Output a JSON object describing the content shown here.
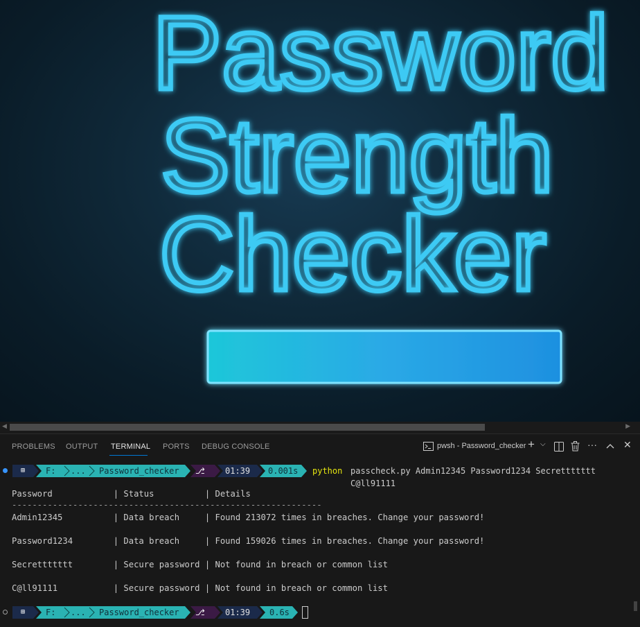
{
  "hero": {
    "title_lines": [
      "Password",
      "Strength",
      "Checker"
    ],
    "colors": {
      "text": "#3ecaf4",
      "bar": "#2ab7e0"
    }
  },
  "panel": {
    "tabs": [
      "PROBLEMS",
      "OUTPUT",
      "TERMINAL",
      "PORTS",
      "DEBUG CONSOLE"
    ],
    "active_tab": "TERMINAL",
    "terminal_name": "pwsh - Password_checker",
    "actions": {
      "add": "+",
      "dropdown": "⌵",
      "split": "split-icon",
      "trash": "trash-icon",
      "more": "···",
      "maximize": "^",
      "close": "✕"
    }
  },
  "prompt1": {
    "drive": "F:",
    "ellipsis": "...",
    "folder": "Password_checker",
    "time": "01:39",
    "duration": "0.001s",
    "command_keyword": "python",
    "command_args": "passcheck.py Admin12345 Password1234 Secrettttttt C@ll91111"
  },
  "table": {
    "header": "Password            | Status          | Details",
    "separator": "-------------------------------------------------------------",
    "rows": [
      "Admin12345          | Data breach     | Found 213072 times in breaches. Change your password!",
      "Password1234        | Data breach     | Found 159026 times in breaches. Change your password!",
      "Secrettttttt        | Secure password | Not found in breach or common list",
      "C@ll91111           | Secure password | Not found in breach or common list"
    ]
  },
  "prompt2": {
    "drive": "F:",
    "ellipsis": "...",
    "folder": "Password_checker",
    "time": "01:39",
    "duration": "0.6s"
  },
  "colors": {
    "teal": "#2ab3b3",
    "navy": "#1b2a4a",
    "purple": "#3b1a45",
    "blue_dot": "#3794ff",
    "yellow": "#e5e510"
  }
}
